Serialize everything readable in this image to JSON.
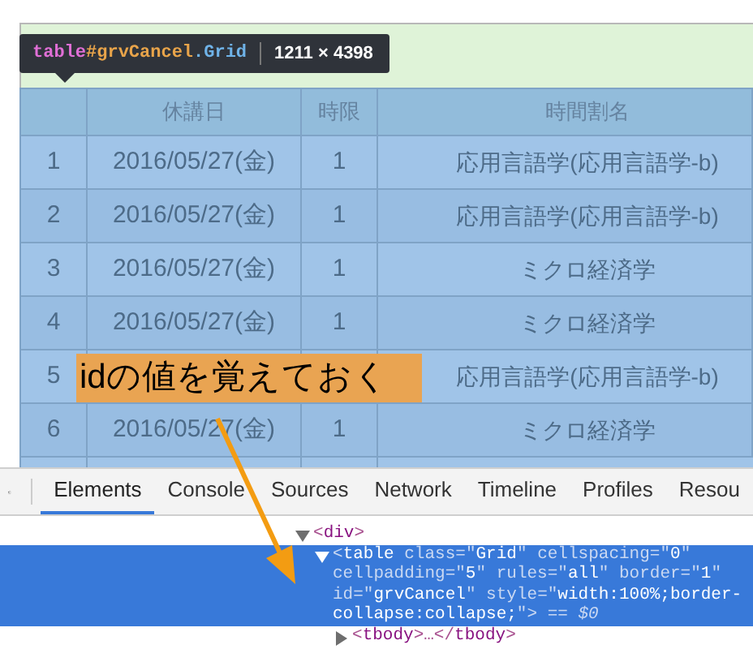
{
  "tooltip": {
    "tag": "table",
    "id": "#grvCancel",
    "class": ".Grid",
    "size": "1211 × 4398"
  },
  "table": {
    "columns": [
      "",
      "休講日",
      "時限",
      "時間割名"
    ],
    "rows": [
      {
        "index": "1",
        "date": "2016/05/27(金)",
        "period": "1",
        "name": "応用言語学(応用言語学-b)"
      },
      {
        "index": "2",
        "date": "2016/05/27(金)",
        "period": "1",
        "name": "応用言語学(応用言語学-b)"
      },
      {
        "index": "3",
        "date": "2016/05/27(金)",
        "period": "1",
        "name": "ミクロ経済学"
      },
      {
        "index": "4",
        "date": "2016/05/27(金)",
        "period": "1",
        "name": "ミクロ経済学"
      },
      {
        "index": "5",
        "name": "応用言語学(応用言語学-b)"
      },
      {
        "index": "6",
        "date": "2016/05/27(金)",
        "period": "1",
        "name": "ミクロ経済学"
      }
    ]
  },
  "annotation": "idの値を覚えておく",
  "devtools": {
    "tabs": [
      {
        "label": "Elements",
        "selected": true
      },
      {
        "label": "Console",
        "selected": false
      },
      {
        "label": "Sources",
        "selected": false
      },
      {
        "label": "Network",
        "selected": false
      },
      {
        "label": "Timeline",
        "selected": false
      },
      {
        "label": "Profiles",
        "selected": false
      },
      {
        "label": "Resou",
        "selected": false
      }
    ],
    "dom_tree": [
      {
        "expanded": true,
        "selected": false,
        "tokens": [
          {
            "kind": "punct",
            "text": "<"
          },
          {
            "kind": "tag",
            "text": "div"
          },
          {
            "kind": "punct",
            "text": ">"
          }
        ],
        "children": [
          {
            "expanded": true,
            "selected": true,
            "tokens": [
              {
                "kind": "punct",
                "text": "<"
              },
              {
                "kind": "tag",
                "text": "table"
              },
              {
                "kind": "attr",
                "text": " class"
              },
              {
                "kind": "punct",
                "text": "=\""
              },
              {
                "kind": "value",
                "text": "Grid"
              },
              {
                "kind": "punct",
                "text": "\""
              },
              {
                "kind": "attr",
                "text": " cellspacing"
              },
              {
                "kind": "punct",
                "text": "=\""
              },
              {
                "kind": "value",
                "text": "0"
              },
              {
                "kind": "punct",
                "text": "\""
              },
              {
                "kind": "attr",
                "text": " cellpadding"
              },
              {
                "kind": "punct",
                "text": "=\""
              },
              {
                "kind": "value",
                "text": "5"
              },
              {
                "kind": "punct",
                "text": "\""
              },
              {
                "kind": "attr",
                "text": " rules"
              },
              {
                "kind": "punct",
                "text": "=\""
              },
              {
                "kind": "value",
                "text": "all"
              },
              {
                "kind": "punct",
                "text": "\""
              },
              {
                "kind": "attr",
                "text": " border"
              },
              {
                "kind": "punct",
                "text": "=\""
              },
              {
                "kind": "value",
                "text": "1"
              },
              {
                "kind": "punct",
                "text": "\""
              },
              {
                "kind": "attr",
                "text": " id"
              },
              {
                "kind": "punct",
                "text": "=\""
              },
              {
                "kind": "value",
                "text": "grvCancel"
              },
              {
                "kind": "punct",
                "text": "\""
              },
              {
                "kind": "attr",
                "text": " style"
              },
              {
                "kind": "punct",
                "text": "=\""
              },
              {
                "kind": "value",
                "text": "width:100%;border-collapse:collapse;"
              },
              {
                "kind": "punct",
                "text": "\">"
              },
              {
                "kind": "marker",
                "text": " == $0"
              }
            ],
            "children": [
              {
                "expanded": false,
                "selected": false,
                "tokens": [
                  {
                    "kind": "punct",
                    "text": "<"
                  },
                  {
                    "kind": "tag",
                    "text": "tbody"
                  },
                  {
                    "kind": "punct",
                    "text": ">…</"
                  },
                  {
                    "kind": "tag",
                    "text": "tbody"
                  },
                  {
                    "kind": "punct",
                    "text": ">"
                  }
                ]
              }
            ]
          }
        ]
      }
    ]
  }
}
